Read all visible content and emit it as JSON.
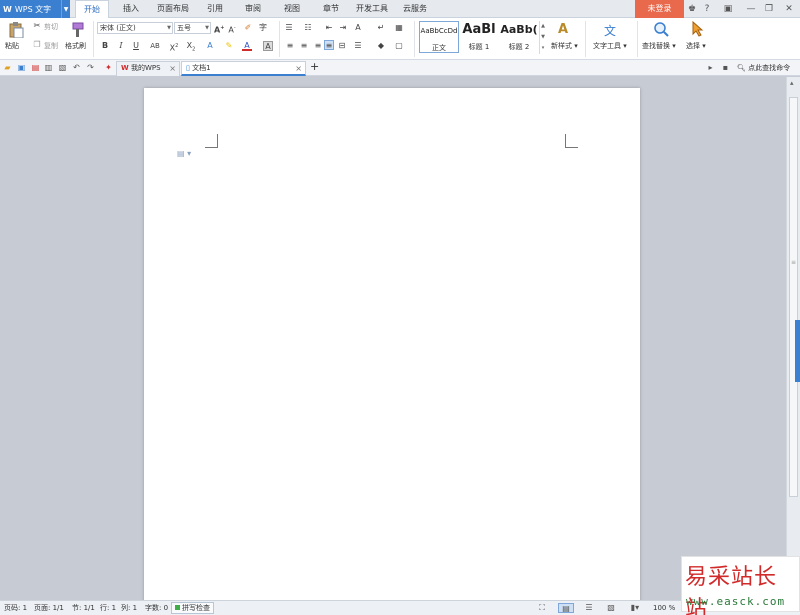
{
  "app": {
    "logo": "W",
    "title": "WPS 文字"
  },
  "menu_tabs": [
    "开始",
    "插入",
    "页面布局",
    "引用",
    "审阅",
    "视图",
    "章节",
    "开发工具",
    "云服务"
  ],
  "login_label": "未登录",
  "window_controls": {
    "help": "?",
    "minimize": "—",
    "restore": "❐",
    "close": "✕"
  },
  "ribbon": {
    "paste_label": "粘贴",
    "cut_label": "剪切",
    "copy_label": "复制",
    "format_painter_label": "格式刷",
    "font_name": "宋体 (正文)",
    "font_size": "五号",
    "styles": [
      {
        "sample": "AaBbCcDd",
        "name": "正文"
      },
      {
        "sample": "AaBl",
        "name": "标题 1"
      },
      {
        "sample": "AaBb(",
        "name": "标题 2"
      }
    ],
    "new_style_label": "新样式",
    "text_tools_label": "文字工具",
    "find_replace_label": "查找替换",
    "select_label": "选择"
  },
  "doc_tabs": [
    {
      "label": "我的WPS",
      "active": false
    },
    {
      "label": "文档1",
      "active": true
    }
  ],
  "add_tab": "+",
  "search_command": "点此查找命令",
  "status": {
    "page": "页码: 1",
    "pages": "页面: 1/1",
    "section": "节: 1/1",
    "row": "行: 1",
    "col": "列: 1",
    "words": "字数: 0",
    "spellcheck": "拼写检查",
    "zoom": "100 %"
  },
  "watermark": {
    "cn": "易采站长站",
    "url": "www.easck.com"
  },
  "colors": {
    "accent": "#3a7fd0",
    "login": "#e9694d",
    "workspace": "#c7cbd3"
  }
}
